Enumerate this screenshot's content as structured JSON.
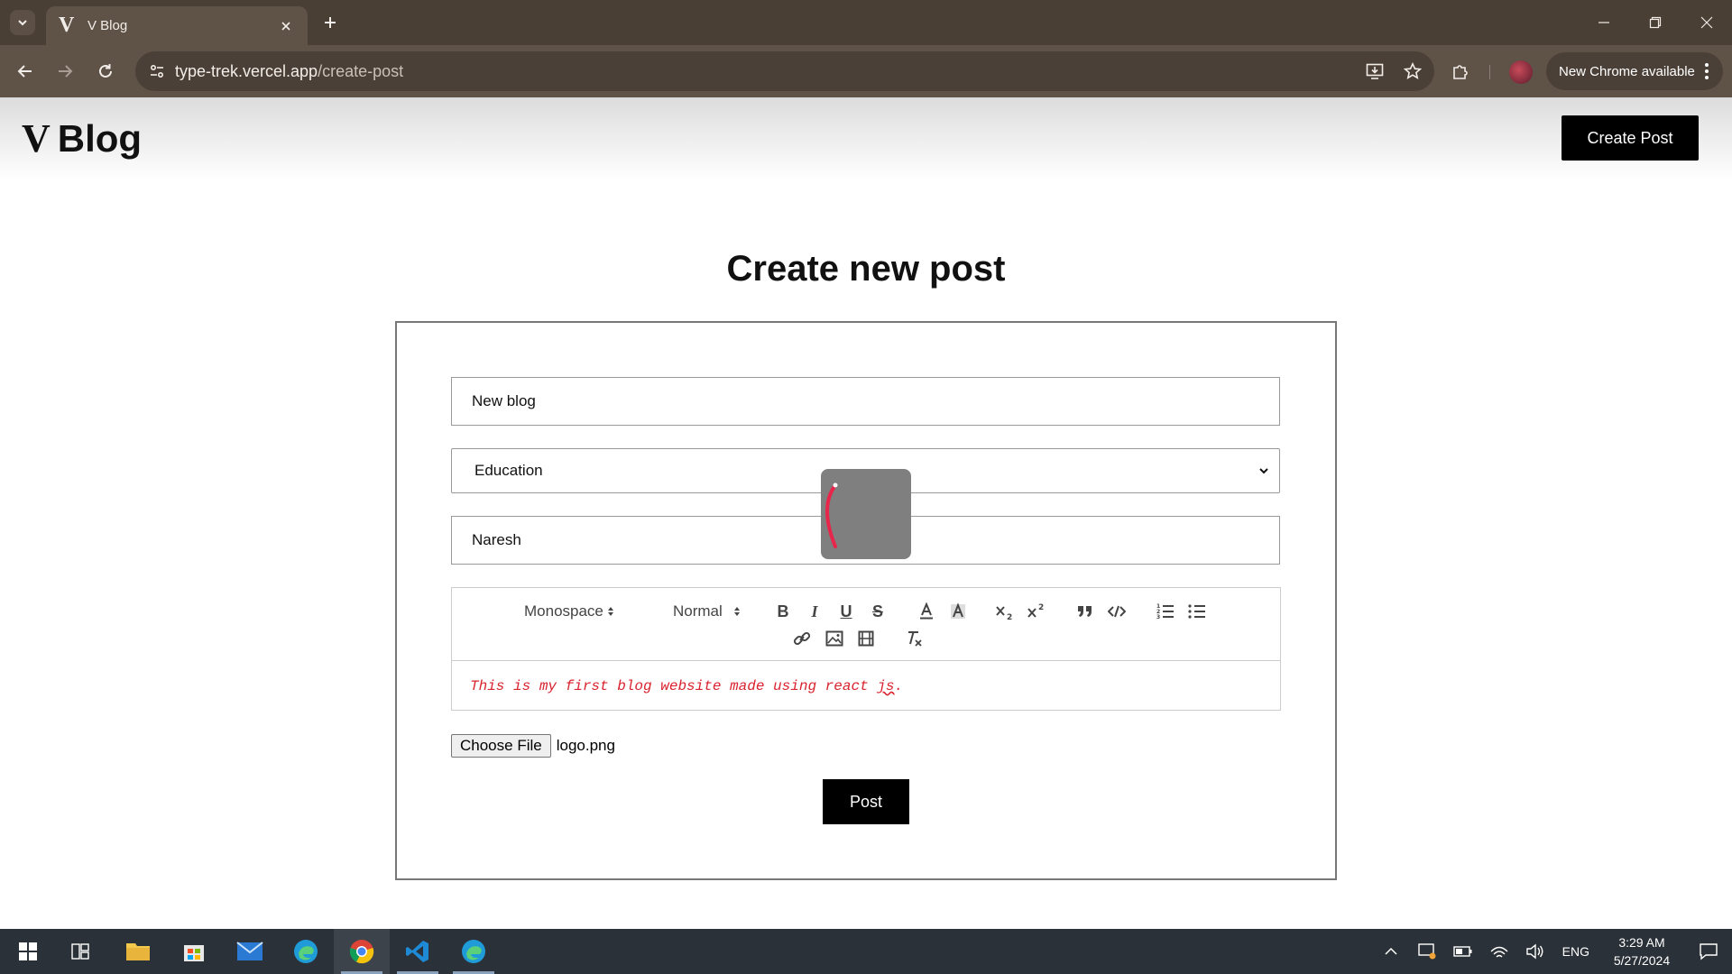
{
  "browser": {
    "tab_title": "V Blog",
    "tab_favicon": "V",
    "url_host": "type-trek.vercel.app",
    "url_path": "/create-post",
    "update_label": "New Chrome available"
  },
  "site": {
    "logo_mark": "V",
    "logo_text": "Blog",
    "create_post_label": "Create Post"
  },
  "page": {
    "title": "Create new post"
  },
  "form": {
    "title_value": "New blog",
    "category_value": "Education",
    "author_value": "Naresh",
    "editor": {
      "font_select": "Monospace",
      "size_select": "Normal",
      "bold_label": "B",
      "italic_label": "I",
      "underline_label": "U",
      "strike_label": "S",
      "content_before": "This is my first blog website made using react ",
      "content_misspelled": "js",
      "content_after": "."
    },
    "choose_file_label": "Choose File",
    "file_name": "logo.png",
    "post_label": "Post"
  },
  "taskbar": {
    "language": "ENG",
    "time": "3:29 AM",
    "date": "5/27/2024"
  },
  "colors": {
    "chrome_tabstrip": "#4a3f35",
    "chrome_toolbar": "#5f5247",
    "editor_text": "#d9232e",
    "loader_arc": "#e8254b",
    "taskbar": "#2b3138"
  }
}
